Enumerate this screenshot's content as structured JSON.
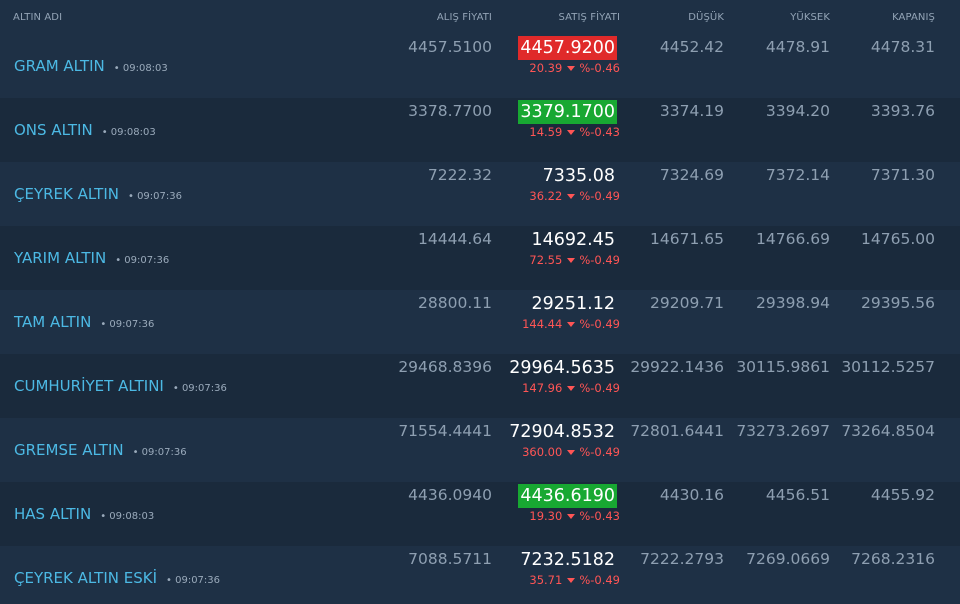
{
  "columns": {
    "name": "ALTIN ADI",
    "alis": "ALIŞ FİYATI",
    "satis": "SATIŞ FİYATI",
    "dusuk": "DÜŞÜK",
    "yuksek": "YÜKSEK",
    "kapanis": "KAPANIŞ"
  },
  "colors": {
    "background": "#1e3045",
    "name_blue": "#4cb9e4",
    "highlight_red": "#e02a2a",
    "highlight_green": "#18a832",
    "change_red": "#ff5555"
  },
  "rows": [
    {
      "name": "GRAM ALTIN",
      "time": "09:08:03",
      "alis": "4457.5100",
      "satis": "4457.9200",
      "highlight": "red",
      "change": "20.39",
      "change_pct": "%-0.46",
      "dusuk": "4452.42",
      "yuksek": "4478.91",
      "kapanis": "4478.31",
      "direction_icon": "caret-down-icon"
    },
    {
      "name": "ONS ALTIN",
      "time": "09:08:03",
      "alis": "3378.7700",
      "satis": "3379.1700",
      "highlight": "green",
      "change": "14.59",
      "change_pct": "%-0.43",
      "dusuk": "3374.19",
      "yuksek": "3394.20",
      "kapanis": "3393.76",
      "direction_icon": "caret-down-icon"
    },
    {
      "name": "ÇEYREK ALTIN",
      "time": "09:07:36",
      "alis": "7222.32",
      "satis": "7335.08",
      "highlight": "none",
      "change": "36.22",
      "change_pct": "%-0.49",
      "dusuk": "7324.69",
      "yuksek": "7372.14",
      "kapanis": "7371.30",
      "direction_icon": "caret-down-icon"
    },
    {
      "name": "YARIM ALTIN",
      "time": "09:07:36",
      "alis": "14444.64",
      "satis": "14692.45",
      "highlight": "none",
      "change": "72.55",
      "change_pct": "%-0.49",
      "dusuk": "14671.65",
      "yuksek": "14766.69",
      "kapanis": "14765.00",
      "direction_icon": "caret-down-icon"
    },
    {
      "name": "TAM ALTIN",
      "time": "09:07:36",
      "alis": "28800.11",
      "satis": "29251.12",
      "highlight": "none",
      "change": "144.44",
      "change_pct": "%-0.49",
      "dusuk": "29209.71",
      "yuksek": "29398.94",
      "kapanis": "29395.56",
      "direction_icon": "caret-down-icon"
    },
    {
      "name": "CUMHURİYET ALTINI",
      "time": "09:07:36",
      "alis": "29468.8396",
      "satis": "29964.5635",
      "highlight": "none",
      "change": "147.96",
      "change_pct": "%-0.49",
      "dusuk": "29922.1436",
      "yuksek": "30115.9861",
      "kapanis": "30112.5257",
      "direction_icon": "caret-down-icon"
    },
    {
      "name": "GREMSE ALTIN",
      "time": "09:07:36",
      "alis": "71554.4441",
      "satis": "72904.8532",
      "highlight": "none",
      "change": "360.00",
      "change_pct": "%-0.49",
      "dusuk": "72801.6441",
      "yuksek": "73273.2697",
      "kapanis": "73264.8504",
      "direction_icon": "caret-down-icon"
    },
    {
      "name": "HAS ALTIN",
      "time": "09:08:03",
      "alis": "4436.0940",
      "satis": "4436.6190",
      "highlight": "green",
      "change": "19.30",
      "change_pct": "%-0.43",
      "dusuk": "4430.16",
      "yuksek": "4456.51",
      "kapanis": "4455.92",
      "direction_icon": "caret-down-icon"
    },
    {
      "name": "ÇEYREK ALTIN ESKİ",
      "time": "09:07:36",
      "alis": "7088.5711",
      "satis": "7232.5182",
      "highlight": "none",
      "change": "35.71",
      "change_pct": "%-0.49",
      "dusuk": "7222.2793",
      "yuksek": "7269.0669",
      "kapanis": "7268.2316",
      "direction_icon": "caret-down-icon"
    }
  ]
}
